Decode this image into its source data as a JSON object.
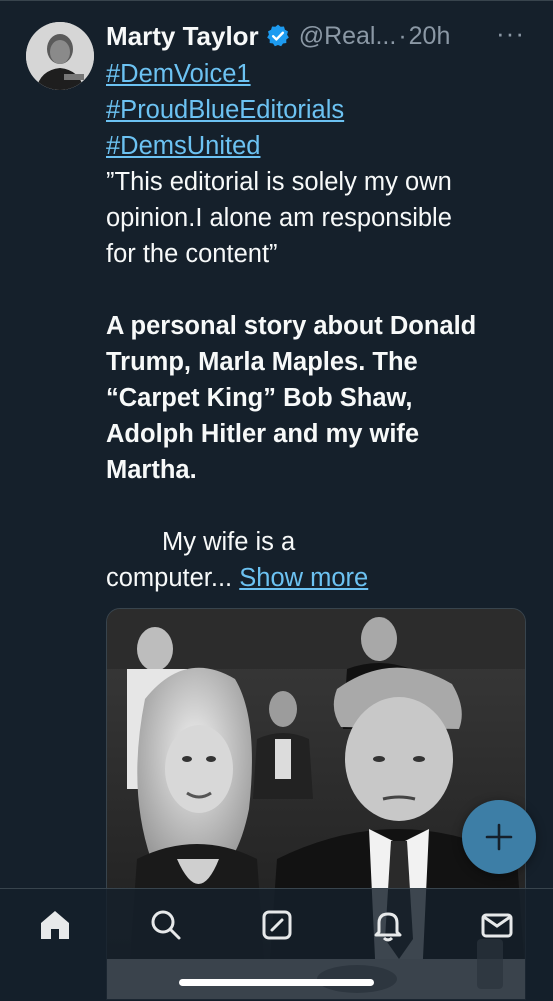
{
  "tweet": {
    "author_name": "Marty Taylor",
    "author_handle": "@Real...",
    "separator": "·",
    "time": "20h",
    "more_label": "···",
    "hashtags": [
      "#DemVoice1",
      "#ProudBlueEditorials",
      "#DemsUnited"
    ],
    "disclaimer_lines": [
      "”This editorial is solely my own",
      "opinion.I alone am responsible",
      "for the content”"
    ],
    "headline_lines": [
      "A personal story about Donald",
      "Trump, Marla Maples. The",
      "“Carpet King” Bob Shaw,",
      "Adolph Hitler and my wife",
      "Martha."
    ],
    "para_line1": "My wife is a",
    "para_line2": "computer...",
    "show_more": "Show more"
  },
  "colors": {
    "background": "#15202b",
    "link": "#6cc2f2",
    "secondary_text": "#8b98a5",
    "verified": "#1d9bf0",
    "fab": "#3d7ea6"
  },
  "nav": {
    "icons": [
      "home-icon",
      "search-icon",
      "compose-icon",
      "notifications-icon",
      "messages-icon"
    ]
  },
  "fab": {
    "label": "+"
  }
}
